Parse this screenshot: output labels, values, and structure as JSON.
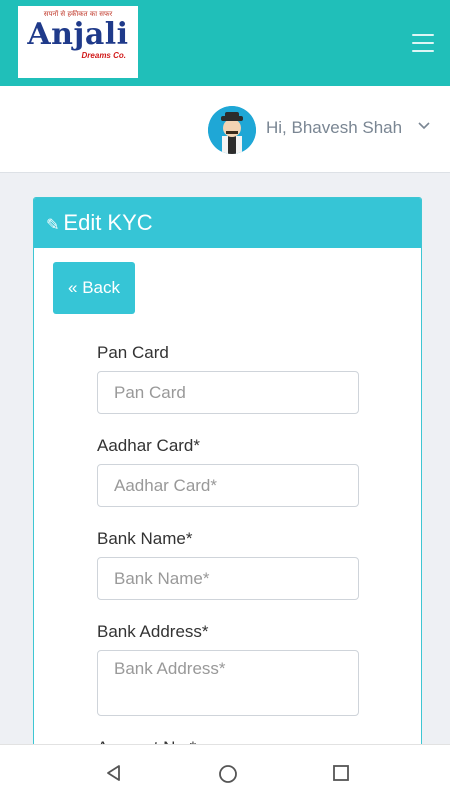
{
  "header": {
    "logo_name": "Anjali",
    "logo_tagline": "सपनों से हकीकत का सफर",
    "logo_sub": "Dreams Co.",
    "menu_icon": "hamburger-icon"
  },
  "user": {
    "greeting": "Hi, Bhavesh Shah",
    "avatar_icon": "user-avatar-icon",
    "dropdown_icon": "chevron-down-icon"
  },
  "card": {
    "title": "Edit KYC",
    "title_icon": "pencil-icon",
    "back_label": "Back",
    "back_icon": "double-chevron-left-icon"
  },
  "form": {
    "pan_label": "Pan Card",
    "pan_placeholder": "Pan Card",
    "aadhar_label": "Aadhar Card*",
    "aadhar_placeholder": "Aadhar Card*",
    "bank_name_label": "Bank Name*",
    "bank_name_placeholder": "Bank Name*",
    "bank_address_label": "Bank Address*",
    "bank_address_placeholder": "Bank Address*",
    "account_label": "Account No.*"
  },
  "colors": {
    "topbar": "#20bfb9",
    "accent": "#36c5d6",
    "logo_text": "#1f3a8a"
  },
  "system_nav": {
    "back_icon": "triangle-back-icon",
    "home_icon": "circle-home-icon",
    "recents_icon": "square-recents-icon"
  }
}
